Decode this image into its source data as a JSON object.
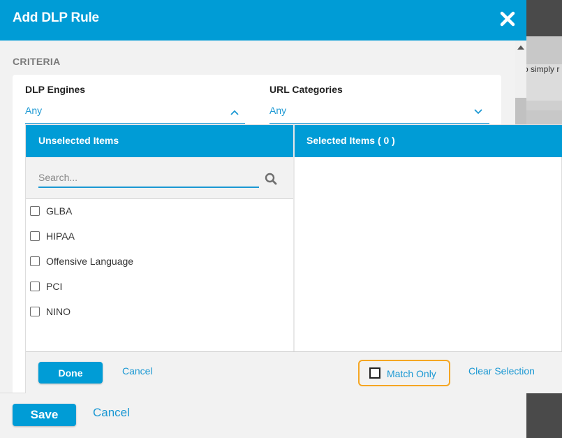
{
  "background": {
    "partial_text": "o simply r"
  },
  "modal": {
    "title": "Add DLP Rule",
    "close_icon": "close-icon",
    "section_label": "CRITERIA",
    "fields": {
      "dlp_engines": {
        "label": "DLP Engines",
        "value": "Any",
        "state": "expanded"
      },
      "url_categories": {
        "label": "URL Categories",
        "value": "Any",
        "state": "collapsed"
      }
    },
    "footer": {
      "save_label": "Save",
      "cancel_label": "Cancel"
    }
  },
  "dropdown": {
    "unselected_header": "Unselected Items",
    "selected_header": "Selected Items ( 0 )",
    "search_placeholder": "Search...",
    "items": [
      {
        "label": "GLBA",
        "checked": false
      },
      {
        "label": "HIPAA",
        "checked": false
      },
      {
        "label": "Offensive Language",
        "checked": false
      },
      {
        "label": "PCI",
        "checked": false
      },
      {
        "label": "NINO",
        "checked": false
      }
    ],
    "done_label": "Done",
    "cancel_label": "Cancel",
    "match_only_label": "Match Only",
    "clear_selection_label": "Clear Selection"
  },
  "colors": {
    "accent": "#009cd6",
    "link": "#1b98d3",
    "highlight": "#f5a623"
  }
}
